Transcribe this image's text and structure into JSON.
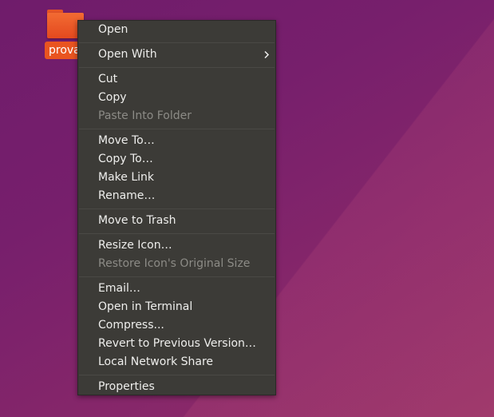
{
  "desktop": {
    "folder_label": "prova"
  },
  "menu": {
    "items": [
      {
        "label": "Open"
      },
      {
        "label": "Open With"
      },
      {
        "label": "Cut"
      },
      {
        "label": "Copy"
      },
      {
        "label": "Paste Into Folder"
      },
      {
        "label": "Move To…"
      },
      {
        "label": "Copy To…"
      },
      {
        "label": "Make Link"
      },
      {
        "label": "Rename…"
      },
      {
        "label": "Move to Trash"
      },
      {
        "label": "Resize Icon…"
      },
      {
        "label": "Restore Icon's Original Size"
      },
      {
        "label": "Email…"
      },
      {
        "label": "Open in Terminal"
      },
      {
        "label": "Compress..."
      },
      {
        "label": "Revert to Previous Version…"
      },
      {
        "label": "Local Network Share"
      },
      {
        "label": "Properties"
      }
    ]
  },
  "colors": {
    "accent": "#e95420",
    "menu_background": "#3c3b37",
    "menu_text": "#eeeeec",
    "disabled_text": "#8c8b86"
  }
}
